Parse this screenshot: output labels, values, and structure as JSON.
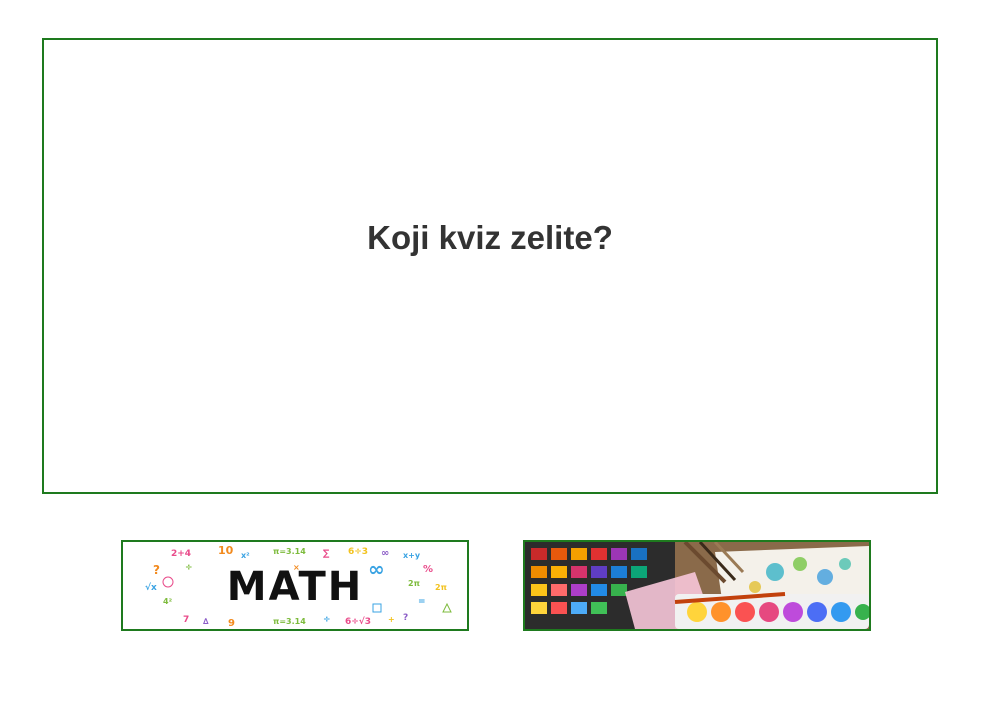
{
  "quiz": {
    "question": "Koji kviz zelite?"
  },
  "options": [
    {
      "label": "MATH",
      "icon": "math-banner-icon"
    },
    {
      "icon": "watercolor-palette-icon"
    }
  ],
  "colors": {
    "border": "#1e7a1e",
    "question_text": "#333333"
  }
}
